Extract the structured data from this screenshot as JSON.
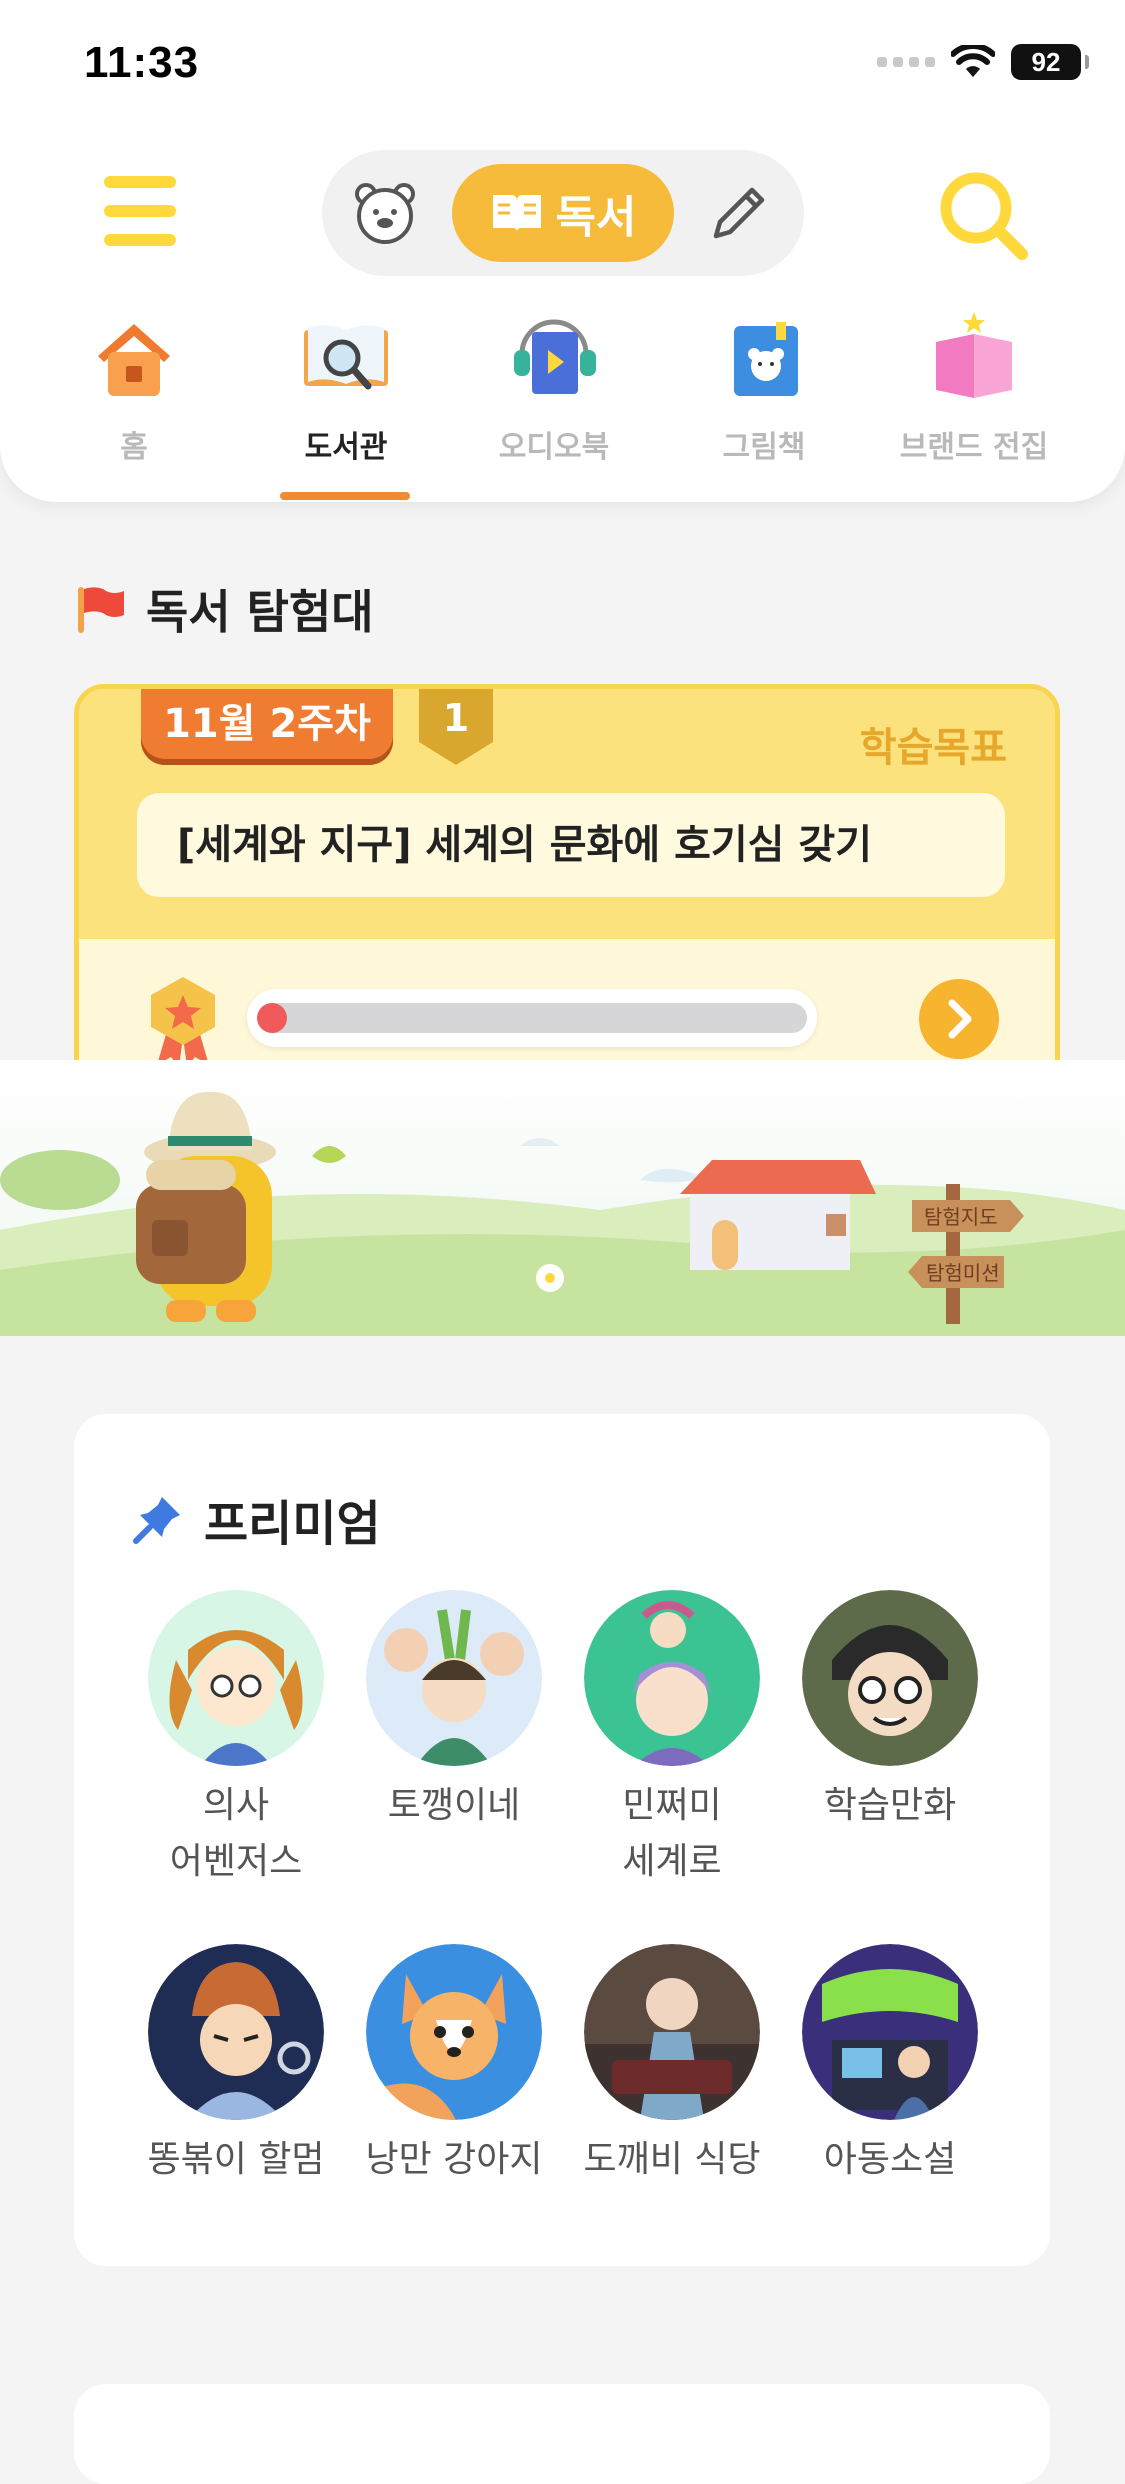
{
  "status": {
    "time": "11:33",
    "battery": "92"
  },
  "header": {
    "mode_active_label": "독서",
    "tabs": [
      {
        "label": "홈"
      },
      {
        "label": "도서관"
      },
      {
        "label": "오디오북"
      },
      {
        "label": "그림책"
      },
      {
        "label": "브랜드 전집"
      }
    ],
    "active_tab": "도서관"
  },
  "explorer": {
    "title": "독서 탐험대",
    "week": "11월 2주차",
    "level": "1",
    "goal_label": "학습목표",
    "goal_text": "[세계와 지구] 세계의 문화에 호기심 갖기",
    "progress": 0.03,
    "signs": [
      "탐험지도",
      "탐험미션"
    ]
  },
  "premium": {
    "title": "프리미엄",
    "items": [
      {
        "name": "의사 어벤저스"
      },
      {
        "name": "토깽이네"
      },
      {
        "name": "민쩌미 세계로"
      },
      {
        "name": "학습만화"
      },
      {
        "name": "똥볶이 할멈"
      },
      {
        "name": "낭만 강아지"
      },
      {
        "name": "도깨비 식당"
      },
      {
        "name": "아동소설"
      }
    ]
  },
  "colors": {
    "accent_yellow": "#ffd93b",
    "reading_pill": "#f6bb3a",
    "tab_underline": "#f08b34",
    "mission_border": "#f9d54e",
    "progress_fill": "#f15a5a"
  }
}
